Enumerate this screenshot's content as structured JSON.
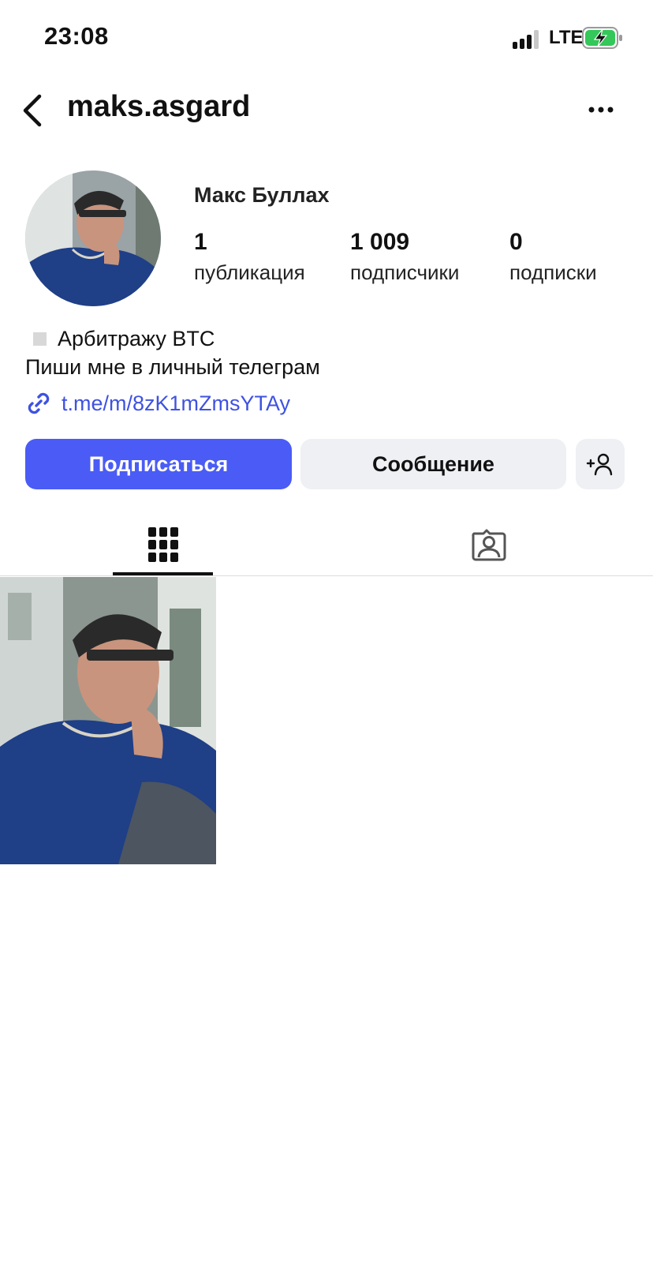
{
  "status_bar": {
    "time": "23:08",
    "network": "LTE",
    "battery_charging": true
  },
  "header": {
    "username": "maks.asgard"
  },
  "profile": {
    "display_name": "Макс Буллах",
    "stats": [
      {
        "value": "1",
        "label": "публикация"
      },
      {
        "value": "1 009",
        "label": "подписчики"
      },
      {
        "value": "0",
        "label": "подписки"
      }
    ],
    "bio": {
      "line1": "Арбитражу BTC",
      "line2": "Пиши мне в личный телеграм",
      "link": "t.me/m/8zK1mZmsYTAy"
    }
  },
  "actions": {
    "follow_label": "Подписаться",
    "message_label": "Сообщение"
  },
  "tabs": [
    {
      "icon": "grid-icon",
      "active": true
    },
    {
      "icon": "tagged-person-icon",
      "active": false
    }
  ],
  "colors": {
    "accent": "#4a5cf5",
    "link": "#3f52e0",
    "secondary_button": "#eff0f4"
  }
}
